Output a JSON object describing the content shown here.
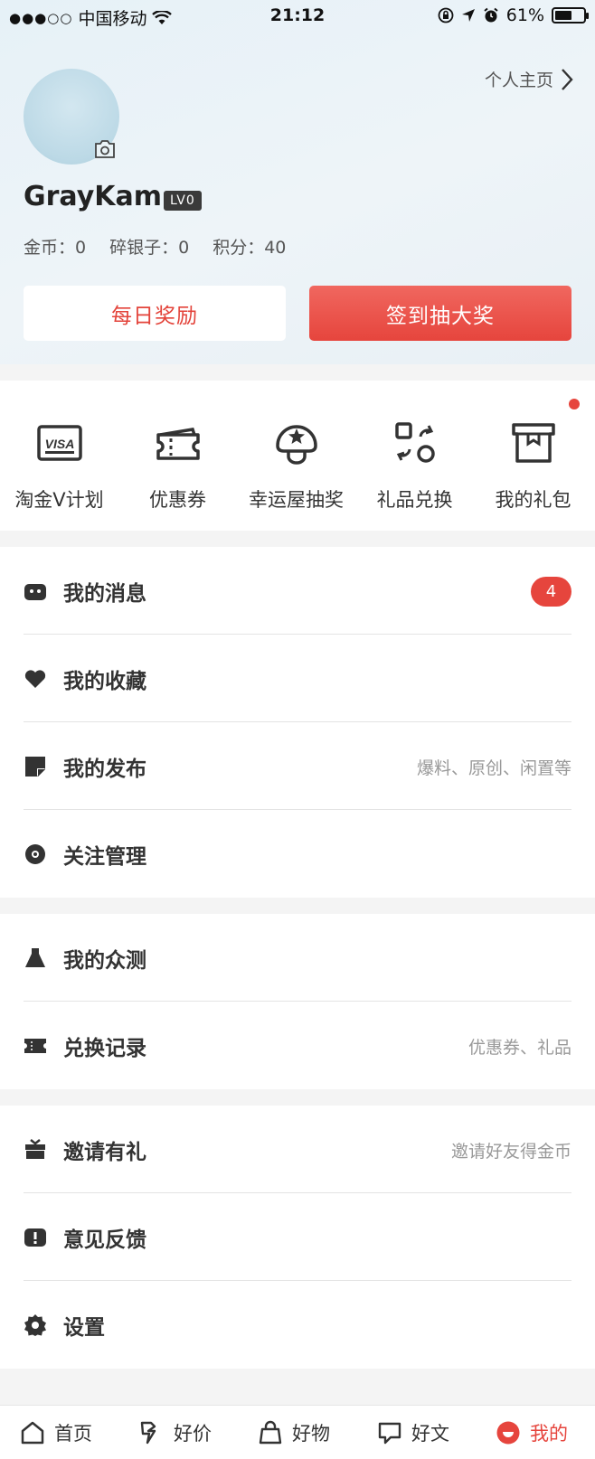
{
  "status_bar": {
    "signal": "●●●○○",
    "carrier": "中国移动",
    "time": "21:12",
    "battery": "61%",
    "battery_level": 0.61
  },
  "header": {
    "profile_link": "个人主页",
    "username": "GrayKam",
    "level": "LV0",
    "stats": [
      {
        "label": "金币：0"
      },
      {
        "label": "碎银子：0"
      },
      {
        "label": "积分：40"
      }
    ],
    "daily_reward": "每日奖励",
    "checkin": "签到抽大奖"
  },
  "quick_actions": [
    {
      "label": "淘金V计划",
      "icon": "visa-card-icon"
    },
    {
      "label": "优惠券",
      "icon": "coupon-ticket-icon"
    },
    {
      "label": "幸运屋抽奖",
      "icon": "lucky-mushroom-icon"
    },
    {
      "label": "礼品兑换",
      "icon": "exchange-icon"
    },
    {
      "label": "我的礼包",
      "icon": "gift-box-icon"
    }
  ],
  "menu_sections": [
    [
      {
        "label": "我的消息",
        "icon": "message-icon",
        "badge": "4",
        "hint": ""
      },
      {
        "label": "我的收藏",
        "icon": "heart-icon",
        "hint": ""
      },
      {
        "label": "我的发布",
        "icon": "note-icon",
        "hint": "爆料、原创、闲置等"
      },
      {
        "label": "关注管理",
        "icon": "follow-icon",
        "hint": ""
      }
    ],
    [
      {
        "label": "我的众测",
        "icon": "flask-icon",
        "hint": ""
      },
      {
        "label": "兑换记录",
        "icon": "ticket-icon",
        "hint": "优惠券、礼品"
      }
    ],
    [
      {
        "label": "邀请有礼",
        "icon": "gift-icon",
        "hint": "邀请好友得金币"
      },
      {
        "label": "意见反馈",
        "icon": "feedback-icon",
        "hint": ""
      },
      {
        "label": "设置",
        "icon": "gear-icon",
        "hint": ""
      }
    ]
  ],
  "tabbar": [
    {
      "label": "首页",
      "icon": "home-icon"
    },
    {
      "label": "好价",
      "icon": "tag-icon"
    },
    {
      "label": "好物",
      "icon": "bag-icon"
    },
    {
      "label": "好文",
      "icon": "article-icon"
    },
    {
      "label": "我的",
      "icon": "me-icon",
      "active": true
    }
  ],
  "colors": {
    "accent": "#e6453d",
    "text": "#333333",
    "hint": "#999999"
  }
}
